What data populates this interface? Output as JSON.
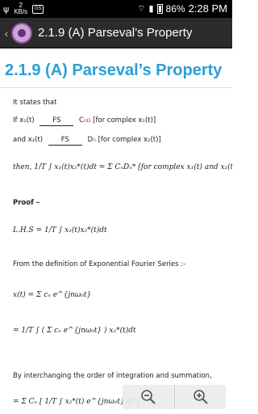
{
  "status_bar": {
    "network_top": "2",
    "network_bottom": "KB/s",
    "notification_badge": "GS",
    "signal_text": "4G",
    "battery": "86%",
    "time": "2:28 PM"
  },
  "action_bar": {
    "title": "2.1.9 (A) Parseval’s Property"
  },
  "page": {
    "title": "2.1.9 (A) Parseval’s Property"
  },
  "doc": {
    "l1": "It states that",
    "l2_pre": "If x₁(t)",
    "fs": "FS",
    "l2_post": "C",
    "l2_sub": "nD",
    "l2_tail": "[for complex x₁(t)]",
    "l3_pre": "and x₂(t)",
    "l3_post": "D",
    "l3_sub": "n",
    "l3_tail": "[for complex x₂(t)]",
    "l4": "then,  1/T ∫ x₁(t)x₂*(t)dt  =  Σ CₙDₙ*   [for complex x₁(t) and x₂(t)]",
    "proof": "Proof –",
    "lhs": "L.H.S  =  1/T ∫ x₁(t)x₂*(t)dt",
    "def": "From the definition of Exponential Fourier Series :-",
    "xt": "x(t)  =  Σ cₙ e^{jnω₀t}",
    "eq2": "=  1/T ∫ ( Σ cₙ e^{jnω₀t} ) x₂*(t)dt",
    "interchange": "By interchanging the order of integration  and summation,",
    "eq3": "=  Σ Cₙ [ 1/T ∫ x₂*(t) e^{jnω₀t} dt ]"
  },
  "zoom": {
    "out_icon": "zoom-out",
    "in_icon": "zoom-in"
  }
}
